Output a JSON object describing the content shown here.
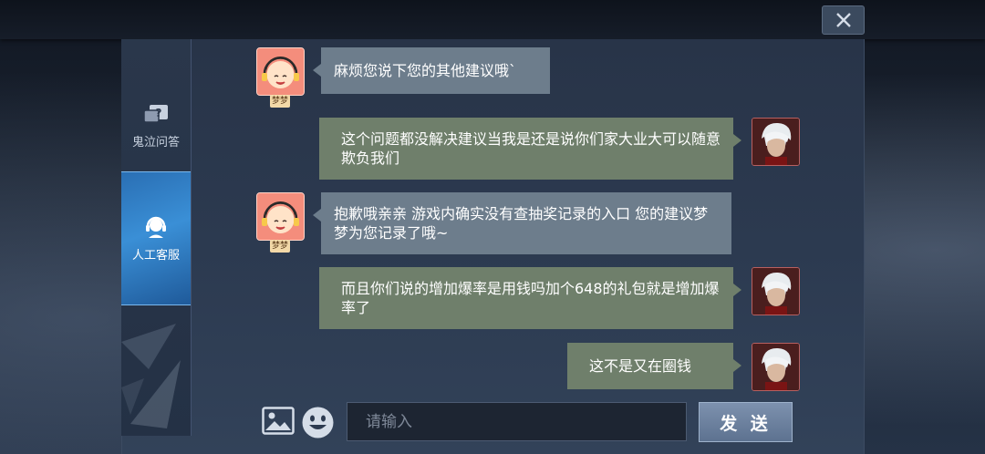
{
  "window": {
    "close_icon": "close-icon"
  },
  "sidebar": {
    "items": [
      {
        "label": "鬼泣问答",
        "icon": "question-chat-icon",
        "active": false
      },
      {
        "label": "人工客服",
        "icon": "headset-agent-icon",
        "active": true
      }
    ]
  },
  "messages": [
    {
      "from": "agent",
      "sender_name": "梦梦",
      "text": "麻烦您说下您的其他建议哦`"
    },
    {
      "from": "user",
      "text": "这个问题都没解决建议当我是还是说你们家大业大可以随意欺负我们"
    },
    {
      "from": "agent",
      "sender_name": "梦梦",
      "text": "抱歉哦亲亲 游戏内确实没有查抽奖记录的入口 您的建议梦梦为您记录了哦~"
    },
    {
      "from": "user",
      "text": "而且你们说的增加爆率是用钱吗加个648的礼包就是增加爆率了"
    },
    {
      "from": "user",
      "text": "这不是又在圈钱"
    }
  ],
  "composer": {
    "image_icon": "image-icon",
    "emoji_icon": "emoji-icon",
    "placeholder": "请输入",
    "value": "",
    "send_label": "发 送"
  },
  "colors": {
    "agent_bubble": "#6d7d8c",
    "user_bubble": "#6f7f6b",
    "active_tab": "#3a8fd6"
  }
}
